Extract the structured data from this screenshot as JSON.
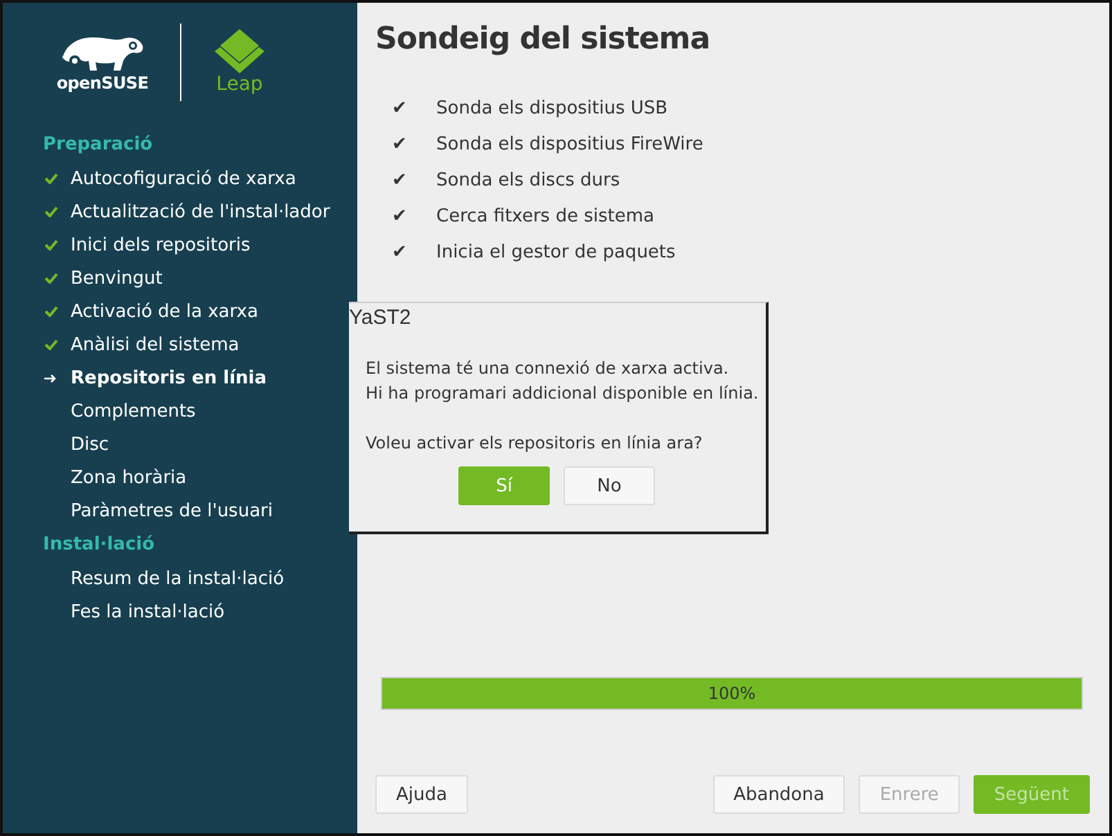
{
  "sidebar": {
    "logo": {
      "brand": "openSUSE",
      "product": "Leap"
    },
    "sections": [
      {
        "title": "Preparació",
        "steps": [
          {
            "label": "Autocofiguració de xarxa",
            "kind": "done"
          },
          {
            "label": "Actualització de l'instal·lador",
            "kind": "done"
          },
          {
            "label": "Inici dels repositoris",
            "kind": "done"
          },
          {
            "label": "Benvingut",
            "kind": "done"
          },
          {
            "label": "Activació de la xarxa",
            "kind": "done"
          },
          {
            "label": "Anàlisi del sistema",
            "kind": "done"
          },
          {
            "label": "Repositoris en línia",
            "kind": "current"
          },
          {
            "label": "Complements",
            "kind": "pending"
          },
          {
            "label": "Disc",
            "kind": "pending"
          },
          {
            "label": "Zona horària",
            "kind": "pending"
          },
          {
            "label": "Paràmetres de l'usuari",
            "kind": "pending"
          }
        ]
      },
      {
        "title": "Instal·lació",
        "steps": [
          {
            "label": "Resum de la instal·lació",
            "kind": "pending"
          },
          {
            "label": "Fes la instal·lació",
            "kind": "pending"
          }
        ]
      }
    ]
  },
  "main": {
    "title": "Sondeig del sistema",
    "tasks": [
      {
        "mark": "✔",
        "label": "Sonda els dispositius USB"
      },
      {
        "mark": "✔",
        "label": "Sonda els dispositius FireWire"
      },
      {
        "mark": "✔",
        "label": "Sonda els discs durs"
      },
      {
        "mark": "✔",
        "label": "Cerca fitxers de sistema"
      },
      {
        "mark": "✔",
        "label": "Inicia el gestor de paquets"
      }
    ],
    "progress": {
      "level": 1,
      "reading": "100%"
    }
  },
  "dialog": {
    "title": "YaST2",
    "lines": [
      "El sistema té una connexió de xarxa activa.",
      "Hi ha programari addicional disponible en línia.",
      "Voleu activar els repositoris en línia ara?"
    ],
    "buttons": [
      {
        "label": "Sí",
        "primary": true
      },
      {
        "label": "No",
        "primary": false
      }
    ]
  },
  "buttons": [
    {
      "label": "Ajuda",
      "primary": false,
      "disabled": false
    },
    {
      "label": "Abandona",
      "primary": false,
      "disabled": false
    },
    {
      "label": "Enrere",
      "primary": false,
      "disabled": true
    },
    {
      "label": "Següent",
      "primary": true,
      "disabled": true
    }
  ]
}
